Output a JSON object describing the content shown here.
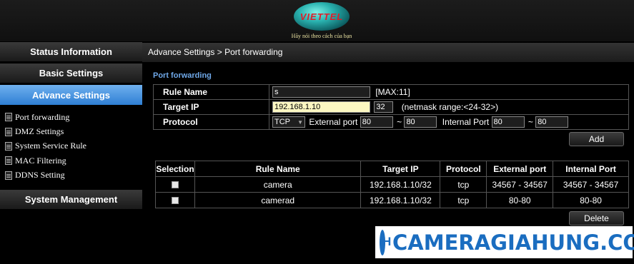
{
  "header": {
    "logo_text": "VIETTEL",
    "slogan": "Hãy nói theo cách của bạn"
  },
  "sidebar": {
    "menu": [
      {
        "label": "Status Information",
        "active": false
      },
      {
        "label": "Basic Settings",
        "active": false
      },
      {
        "label": "Advance Settings",
        "active": true
      }
    ],
    "submenu": [
      {
        "label": "Port forwarding"
      },
      {
        "label": "DMZ Settings"
      },
      {
        "label": "System Service Rule"
      },
      {
        "label": "MAC Filtering"
      },
      {
        "label": "DDNS Setting"
      }
    ],
    "bottom_menu": {
      "label": "System Management"
    }
  },
  "breadcrumb": "Advance Settings > Port forwarding",
  "section_title": "Port forwarding",
  "form": {
    "rule_name": {
      "label": "Rule Name",
      "value": "s",
      "hint": "[MAX:11]"
    },
    "target_ip": {
      "label": "Target IP",
      "value": "192.168.1.10",
      "mask": "32",
      "hint": "(netmask range:<24-32>)"
    },
    "protocol": {
      "label": "Protocol",
      "selected": "TCP",
      "external_label": "External port",
      "external_from": "80",
      "external_to": "80",
      "internal_label": "Internal Port",
      "internal_from": "80",
      "internal_to": "80",
      "separator": "~"
    }
  },
  "buttons": {
    "add": "Add",
    "delete": "Delete"
  },
  "table": {
    "headers": [
      "Selection",
      "Rule Name",
      "Target IP",
      "Protocol",
      "External port",
      "Internal Port"
    ],
    "rows": [
      {
        "rule": "camera",
        "ip": "192.168.1.10/32",
        "protocol": "tcp",
        "external": "34567 - 34567",
        "internal": "34567 - 34567"
      },
      {
        "rule": "camerad",
        "ip": "192.168.1.10/32",
        "protocol": "tcp",
        "external": "80-80",
        "internal": "80-80"
      }
    ]
  },
  "watermark": {
    "logo": "H",
    "text": "CAMERAGIAHUNG.COM"
  },
  "colors": {
    "accent_blue": "#2f7fd4",
    "section_title": "#6fa8e8",
    "logo_red": "#e01e2a",
    "watermark_blue": "#1a6dc0"
  }
}
